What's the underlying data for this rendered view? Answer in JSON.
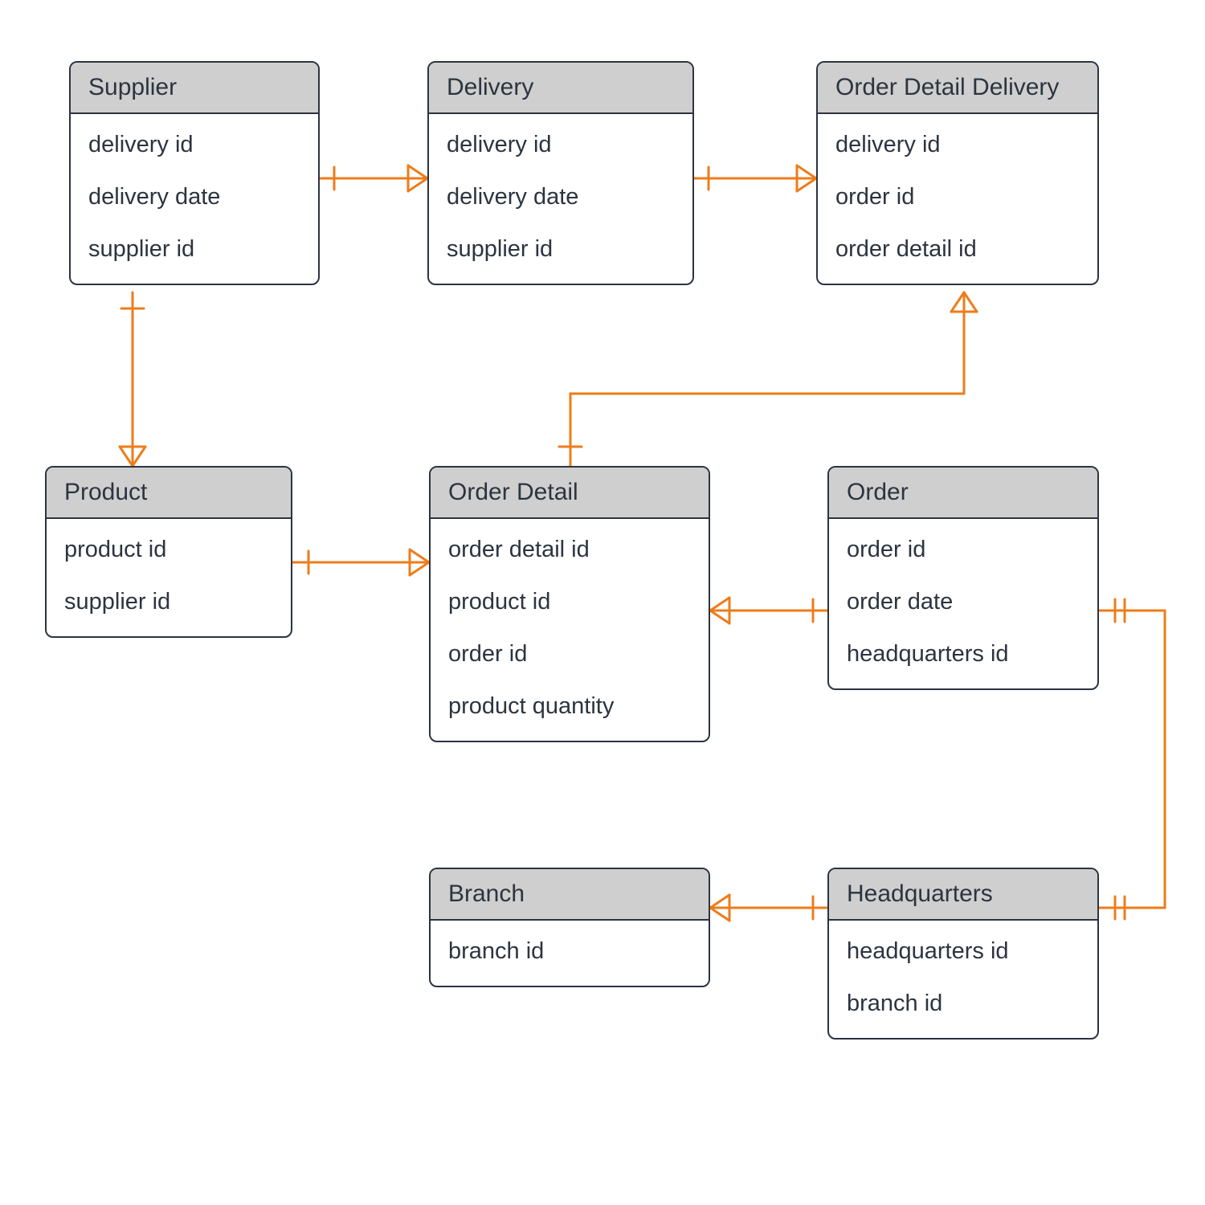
{
  "entities": {
    "supplier": {
      "title": "Supplier",
      "fields": [
        "delivery id",
        "delivery date",
        "supplier id"
      ]
    },
    "delivery": {
      "title": "Delivery",
      "fields": [
        "delivery id",
        "delivery date",
        "supplier id"
      ]
    },
    "order_detail_delivery": {
      "title": "Order Detail Delivery",
      "fields": [
        "delivery id",
        "order id",
        "order detail id"
      ]
    },
    "product": {
      "title": "Product",
      "fields": [
        "product id",
        "supplier id"
      ]
    },
    "order_detail": {
      "title": "Order Detail",
      "fields": [
        "order detail id",
        "product id",
        "order id",
        "product quantity"
      ]
    },
    "order": {
      "title": "Order",
      "fields": [
        "order id",
        "order date",
        "headquarters id"
      ]
    },
    "branch": {
      "title": "Branch",
      "fields": [
        "branch id"
      ]
    },
    "headquarters": {
      "title": "Headquarters",
      "fields": [
        "headquarters id",
        "branch id"
      ]
    }
  },
  "relationships": [
    {
      "from": "supplier",
      "to": "delivery",
      "type": "one-to-many"
    },
    {
      "from": "delivery",
      "to": "order_detail_delivery",
      "type": "one-to-many"
    },
    {
      "from": "supplier",
      "to": "product",
      "type": "one-to-many"
    },
    {
      "from": "product",
      "to": "order_detail",
      "type": "one-to-many"
    },
    {
      "from": "order_detail",
      "to": "order_detail_delivery",
      "type": "many-to-one"
    },
    {
      "from": "order",
      "to": "order_detail",
      "type": "one-to-many"
    },
    {
      "from": "headquarters",
      "to": "order",
      "type": "one-to-one"
    },
    {
      "from": "headquarters",
      "to": "branch",
      "type": "one-to-many"
    }
  ],
  "colors": {
    "connector": "#ee7c1a",
    "box_border": "#2c3440",
    "header_bg": "#cfcfcf"
  }
}
